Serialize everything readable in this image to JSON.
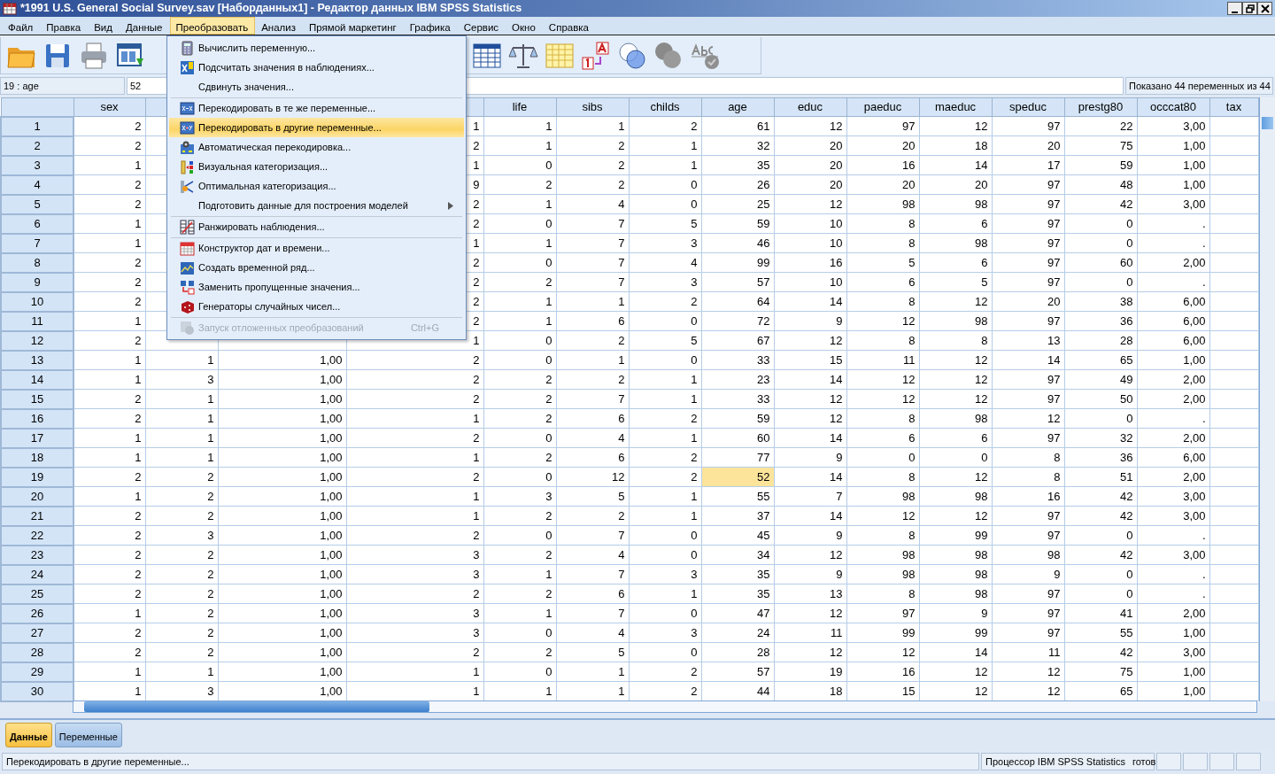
{
  "window": {
    "title": "*1991 U.S. General Social Survey.sav [Наборданных1] - Редактор данных IBM SPSS Statistics"
  },
  "menu_bar": [
    {
      "label": "Файл",
      "selected": false
    },
    {
      "label": "Правка",
      "selected": false
    },
    {
      "label": "Вид",
      "selected": false
    },
    {
      "label": "Данные",
      "selected": false
    },
    {
      "label": "Преобразовать",
      "selected": true
    },
    {
      "label": "Анализ",
      "selected": false
    },
    {
      "label": "Прямой маркетинг",
      "selected": false
    },
    {
      "label": "Графика",
      "selected": false
    },
    {
      "label": "Сервис",
      "selected": false
    },
    {
      "label": "Окно",
      "selected": false
    },
    {
      "label": "Справка",
      "selected": false
    }
  ],
  "transform_menu": {
    "items": [
      {
        "kind": "item",
        "label": "Вычислить переменную...",
        "selected": false,
        "disabled": false
      },
      {
        "kind": "item",
        "label": "Подсчитать значения в наблюдениях...",
        "selected": false,
        "disabled": false
      },
      {
        "kind": "item",
        "label": "Сдвинуть значения...",
        "selected": false,
        "disabled": false
      },
      {
        "kind": "separator"
      },
      {
        "kind": "item",
        "label": "Перекодировать в те же переменные...",
        "selected": false,
        "disabled": false
      },
      {
        "kind": "item",
        "label": "Перекодировать в другие переменные...",
        "selected": true,
        "disabled": false
      },
      {
        "kind": "item",
        "label": "Автоматическая перекодировка...",
        "selected": false,
        "disabled": false
      },
      {
        "kind": "item",
        "label": "Визуальная категоризация...",
        "selected": false,
        "disabled": false
      },
      {
        "kind": "item",
        "label": "Оптимальная категоризация...",
        "selected": false,
        "disabled": false
      },
      {
        "kind": "submenu",
        "label": "Подготовить данные для построения моделей",
        "selected": false,
        "disabled": false
      },
      {
        "kind": "separator"
      },
      {
        "kind": "item",
        "label": "Ранжировать наблюдения...",
        "selected": false,
        "disabled": false
      },
      {
        "kind": "separator"
      },
      {
        "kind": "item",
        "label": "Конструктор дат и времени...",
        "selected": false,
        "disabled": false
      },
      {
        "kind": "item",
        "label": "Создать временной ряд...",
        "selected": false,
        "disabled": false
      },
      {
        "kind": "item",
        "label": "Заменить пропущенные значения...",
        "selected": false,
        "disabled": false
      },
      {
        "kind": "item",
        "label": "Генераторы случайных чисел...",
        "selected": false,
        "disabled": false
      },
      {
        "kind": "separator"
      },
      {
        "kind": "item",
        "label": "Запуск отложенных преобразований",
        "shortcut": "Ctrl+G",
        "selected": false,
        "disabled": true
      }
    ]
  },
  "cell_editor": {
    "reference": "19 : age",
    "value": "52"
  },
  "variables_shown": "Показано 44 переменных из 44",
  "table": {
    "columns": [
      "sex",
      null,
      null,
      null,
      "life",
      "sibs",
      "childs",
      "age",
      "educ",
      "paeduc",
      "maeduc",
      "speduc",
      "prestg80",
      "occcat80",
      "tax"
    ],
    "rows": [
      {
        "number": "1",
        "cells": [
          "2",
          null,
          null,
          "1",
          "1",
          "1",
          "2",
          "61",
          "12",
          "97",
          "12",
          "97",
          "22",
          "3,00"
        ]
      },
      {
        "number": "2",
        "cells": [
          "2",
          null,
          null,
          "2",
          "1",
          "2",
          "1",
          "32",
          "20",
          "20",
          "18",
          "20",
          "75",
          "1,00"
        ]
      },
      {
        "number": "3",
        "cells": [
          "1",
          null,
          null,
          "1",
          "0",
          "2",
          "1",
          "35",
          "20",
          "16",
          "14",
          "17",
          "59",
          "1,00"
        ]
      },
      {
        "number": "4",
        "cells": [
          "2",
          null,
          null,
          "9",
          "2",
          "2",
          "0",
          "26",
          "20",
          "20",
          "20",
          "97",
          "48",
          "1,00"
        ]
      },
      {
        "number": "5",
        "cells": [
          "2",
          null,
          null,
          "2",
          "1",
          "4",
          "0",
          "25",
          "12",
          "98",
          "98",
          "97",
          "42",
          "3,00"
        ]
      },
      {
        "number": "6",
        "cells": [
          "1",
          null,
          null,
          "2",
          "0",
          "7",
          "5",
          "59",
          "10",
          "8",
          "6",
          "97",
          "0",
          "."
        ]
      },
      {
        "number": "7",
        "cells": [
          "1",
          null,
          null,
          "1",
          "1",
          "7",
          "3",
          "46",
          "10",
          "8",
          "98",
          "97",
          "0",
          "."
        ]
      },
      {
        "number": "8",
        "cells": [
          "2",
          null,
          null,
          "2",
          "0",
          "7",
          "4",
          "99",
          "16",
          "5",
          "6",
          "97",
          "60",
          "2,00"
        ]
      },
      {
        "number": "9",
        "cells": [
          "2",
          null,
          null,
          "2",
          "2",
          "7",
          "3",
          "57",
          "10",
          "6",
          "5",
          "97",
          "0",
          "."
        ]
      },
      {
        "number": "10",
        "cells": [
          "2",
          null,
          null,
          "2",
          "1",
          "1",
          "2",
          "64",
          "14",
          "8",
          "12",
          "20",
          "38",
          "6,00"
        ]
      },
      {
        "number": "11",
        "cells": [
          "1",
          null,
          null,
          "2",
          "1",
          "6",
          "0",
          "72",
          "9",
          "12",
          "98",
          "97",
          "36",
          "6,00"
        ]
      },
      {
        "number": "12",
        "cells": [
          "2",
          null,
          null,
          "1",
          "0",
          "2",
          "5",
          "67",
          "12",
          "8",
          "8",
          "13",
          "28",
          "6,00"
        ]
      },
      {
        "number": "13",
        "cells": [
          "1",
          "1",
          "1,00",
          "2",
          "0",
          "1",
          "0",
          "33",
          "15",
          "11",
          "12",
          "14",
          "65",
          "1,00"
        ]
      },
      {
        "number": "14",
        "cells": [
          "1",
          "3",
          "1,00",
          "2",
          "2",
          "2",
          "1",
          "23",
          "14",
          "12",
          "12",
          "97",
          "49",
          "2,00"
        ]
      },
      {
        "number": "15",
        "cells": [
          "2",
          "1",
          "1,00",
          "2",
          "2",
          "7",
          "1",
          "33",
          "12",
          "12",
          "12",
          "97",
          "50",
          "2,00"
        ]
      },
      {
        "number": "16",
        "cells": [
          "2",
          "1",
          "1,00",
          "1",
          "2",
          "6",
          "2",
          "59",
          "12",
          "8",
          "98",
          "12",
          "0",
          "."
        ]
      },
      {
        "number": "17",
        "cells": [
          "1",
          "1",
          "1,00",
          "2",
          "0",
          "4",
          "1",
          "60",
          "14",
          "6",
          "6",
          "97",
          "32",
          "2,00"
        ]
      },
      {
        "number": "18",
        "cells": [
          "1",
          "1",
          "1,00",
          "1",
          "2",
          "6",
          "2",
          "77",
          "9",
          "0",
          "0",
          "8",
          "36",
          "6,00"
        ]
      },
      {
        "number": "19",
        "cells": [
          "2",
          "2",
          "1,00",
          "2",
          "0",
          "12",
          "2",
          {
            "text": "52",
            "selected": true
          },
          "14",
          "8",
          "12",
          "8",
          "51",
          "2,00"
        ]
      },
      {
        "number": "20",
        "cells": [
          "1",
          "2",
          "1,00",
          "1",
          "3",
          "5",
          "1",
          "55",
          "7",
          "98",
          "98",
          "16",
          "42",
          "3,00"
        ]
      },
      {
        "number": "21",
        "cells": [
          "2",
          "2",
          "1,00",
          "1",
          "2",
          "2",
          "1",
          "37",
          "14",
          "12",
          "12",
          "97",
          "42",
          "3,00"
        ]
      },
      {
        "number": "22",
        "cells": [
          "2",
          "3",
          "1,00",
          "2",
          "0",
          "7",
          "0",
          "45",
          "9",
          "8",
          "99",
          "97",
          "0",
          "."
        ]
      },
      {
        "number": "23",
        "cells": [
          "2",
          "2",
          "1,00",
          "3",
          "2",
          "4",
          "0",
          "34",
          "12",
          "98",
          "98",
          "98",
          "42",
          "3,00"
        ]
      },
      {
        "number": "24",
        "cells": [
          "2",
          "2",
          "1,00",
          "3",
          "1",
          "7",
          "3",
          "35",
          "9",
          "98",
          "98",
          "9",
          "0",
          "."
        ]
      },
      {
        "number": "25",
        "cells": [
          "2",
          "2",
          "1,00",
          "2",
          "2",
          "6",
          "1",
          "35",
          "13",
          "8",
          "98",
          "97",
          "0",
          "."
        ]
      },
      {
        "number": "26",
        "cells": [
          "1",
          "2",
          "1,00",
          "3",
          "1",
          "7",
          "0",
          "47",
          "12",
          "97",
          "9",
          "97",
          "41",
          "2,00"
        ]
      },
      {
        "number": "27",
        "cells": [
          "2",
          "2",
          "1,00",
          "3",
          "0",
          "4",
          "3",
          "24",
          "11",
          "99",
          "99",
          "97",
          "55",
          "1,00"
        ]
      },
      {
        "number": "28",
        "cells": [
          "2",
          "2",
          "1,00",
          "2",
          "2",
          "5",
          "0",
          "28",
          "12",
          "12",
          "14",
          "11",
          "42",
          "3,00"
        ]
      },
      {
        "number": "29",
        "cells": [
          "1",
          "1",
          "1,00",
          "1",
          "0",
          "1",
          "2",
          "57",
          "19",
          "16",
          "12",
          "12",
          "75",
          "1,00"
        ]
      },
      {
        "number": "30",
        "cells": [
          "1",
          "3",
          "1,00",
          "1",
          "1",
          "1",
          "2",
          "44",
          "18",
          "15",
          "12",
          "12",
          "65",
          "1,00"
        ]
      }
    ]
  },
  "view_tabs": [
    {
      "label": "Данные",
      "selected": true
    },
    {
      "label": "Переменные",
      "selected": false
    }
  ],
  "status_bar": {
    "message": "Перекодировать в другие переменные...",
    "processor": "Процессор IBM SPSS Statistics",
    "state": "готов"
  }
}
